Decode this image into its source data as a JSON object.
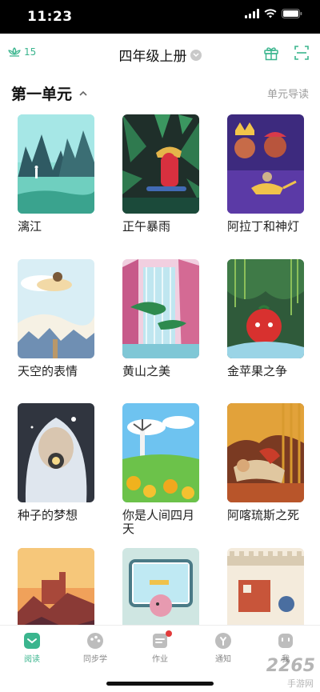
{
  "status_bar": {
    "time": "11:23"
  },
  "header": {
    "badge_count": "15",
    "title": "四年级上册",
    "gift_icon": "gift-icon",
    "scan_icon": "scan-icon"
  },
  "section": {
    "title": "第一单元",
    "link": "单元导读"
  },
  "books": [
    {
      "title": "漓江"
    },
    {
      "title": "正午暴雨"
    },
    {
      "title": "阿拉丁和神灯"
    },
    {
      "title": "天空的表情"
    },
    {
      "title": "黄山之美"
    },
    {
      "title": "金苹果之争"
    },
    {
      "title": "种子的梦想"
    },
    {
      "title": "你是人间四月天"
    },
    {
      "title": "阿喀琉斯之死"
    },
    {
      "title": ""
    },
    {
      "title": ""
    },
    {
      "title": ""
    }
  ],
  "tabs": [
    {
      "label": "阅读"
    },
    {
      "label": "同步学"
    },
    {
      "label": "作业"
    },
    {
      "label": "通知"
    },
    {
      "label": "我"
    }
  ],
  "watermark": {
    "brand": "2265",
    "sub": "手游网"
  },
  "colors": {
    "accent": "#3bb58e",
    "notify_dot": "#e23b3b"
  }
}
